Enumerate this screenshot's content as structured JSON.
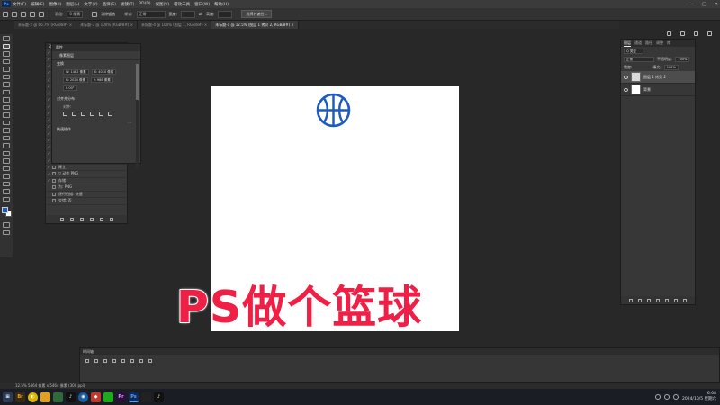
{
  "app": {
    "logo": "Ps",
    "menu": [
      "文件(F)",
      "编辑(E)",
      "图像(I)",
      "图层(L)",
      "文字(Y)",
      "选择(S)",
      "滤镜(T)",
      "3D(D)",
      "视图(V)",
      "增效工具",
      "窗口(W)",
      "帮助(H)"
    ],
    "window_controls": [
      "—",
      "□",
      "✕"
    ]
  },
  "options_bar": {
    "feather_label": "羽化:",
    "feather_value": "0 像素",
    "antialias_label": "消除锯齿",
    "style_label": "样式:",
    "style_value": "正常",
    "width_label": "宽度:",
    "height_label": "高度:",
    "select_mask_button": "选择并遮住..."
  },
  "tabs": [
    {
      "label": "未标题-2 @ 66.7% (RGB/8#) ×",
      "active": false
    },
    {
      "label": "未标题-3 @ 100% (RGB/8#) ×",
      "active": false
    },
    {
      "label": "未标题-4 @ 100% (图层 1, RGB/8#) ×",
      "active": false
    },
    {
      "label": "未标题-1 @ 12.5% (图层 1 拷贝 2, RGB/8#) ×",
      "active": true
    }
  ],
  "actions_panel": {
    "title": "动作",
    "rows": [
      {
        "text": "默认动作",
        "check": "✓"
      },
      {
        "text": "",
        "check": "✓"
      },
      {
        "text": "",
        "check": "✓"
      },
      {
        "text": "",
        "check": "✓"
      },
      {
        "text": "",
        "check": "✓"
      },
      {
        "text": "",
        "check": "✓"
      },
      {
        "text": "",
        "check": "✓"
      },
      {
        "text": "",
        "check": "✓"
      },
      {
        "text": "",
        "check": "✓"
      },
      {
        "text": "",
        "check": "✓"
      },
      {
        "text": "",
        "check": "✓"
      },
      {
        "text": "",
        "check": "✓"
      },
      {
        "text": "",
        "check": "✓"
      },
      {
        "text": "",
        "check": "✓"
      },
      {
        "text": "",
        "check": "✓"
      },
      {
        "text": "Portraiture",
        "check": "✓"
      },
      {
        "text": "应用图像",
        "check": "✓"
      },
      {
        "text": "建立",
        "check": "✓"
      },
      {
        "text": "▽ 动作 PNG",
        "check": "✓"
      },
      {
        "text": "存储",
        "check": "✓"
      },
      {
        "text": "为: PNG",
        "check": ""
      },
      {
        "text": "逐行扫描: 快速",
        "check": ""
      },
      {
        "text": "交错: 否",
        "check": ""
      }
    ]
  },
  "properties_panel": {
    "title": "属性",
    "subtitle": "像素图层",
    "transform_label": "变换",
    "w": "W: 1482 像素",
    "x": "X: 4010 像素",
    "h": "H: 2024 像素",
    "y": "Y: 988 像素",
    "angle": "0.00°",
    "align_label": "对齐并分布",
    "align_sub": "对齐:",
    "quick_actions_label": "快速操作",
    "more": "..."
  },
  "layers_panel": {
    "tabs": [
      "图层",
      "通道",
      "路径",
      "调整",
      "库"
    ],
    "filter_label": "Q 类型",
    "blend_mode": "正常",
    "opacity_label": "不透明度:",
    "opacity_value": "100%",
    "lock_label": "锁定:",
    "fill_label": "填充:",
    "fill_value": "100%",
    "layers": [
      {
        "name": "图层 1 拷贝 2",
        "selected": true
      },
      {
        "name": "背景",
        "selected": false
      }
    ]
  },
  "timeline": {
    "title": "时间轴"
  },
  "status": {
    "text": "12.5%   5464 像素 x 5464 像素 (300 ppi)"
  },
  "overlay_title": "PS做个篮球",
  "colors": {
    "foreground": "#1d5bbf",
    "background": "#ffffff",
    "basketball_stroke": "#1d5bbf",
    "title_fill": "#f01f45"
  },
  "taskbar": {
    "apps": [
      "⊞",
      "Br",
      "◐",
      "",
      "",
      "♪",
      "◉",
      "◆",
      "",
      "Pr",
      "Ps",
      "",
      "♪"
    ],
    "time": "6:08",
    "date": "2024/10/5 星期六"
  }
}
